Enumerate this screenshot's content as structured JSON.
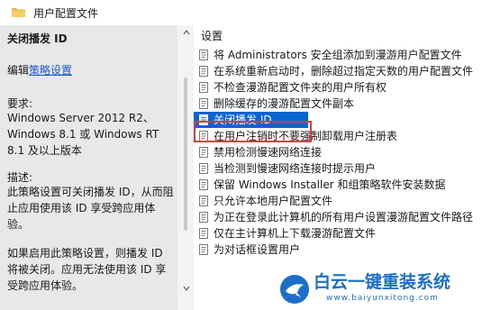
{
  "header": {
    "title": "用户配置文件"
  },
  "left_panel": {
    "title": "关闭播发 ID",
    "edit_prefix": "编辑",
    "edit_link": "策略设置",
    "requirements_label": "要求:",
    "requirements_value": "Windows Server 2012 R2、Windows 8.1 或 Windows RT 8.1 及以上版本",
    "description_label": "描述:",
    "description_value": "此策略设置可关闭播发 ID，从而阻止应用使用该 ID 享受跨应用体验。",
    "enabled_text": "如果启用此策略设置，则播发 ID 将被关闭。应用无法使用该 ID 享受跨应用体验。"
  },
  "list": {
    "column_header": "设置",
    "items": [
      {
        "label": "将 Administrators 安全组添加到漫游用户配置文件",
        "selected": false
      },
      {
        "label": "在系统重新启动时，删除超过指定天数的用户配置文件",
        "selected": false
      },
      {
        "label": "不检查漫游配置文件夹的用户所有权",
        "selected": false
      },
      {
        "label": "删除缓存的漫游配置文件副本",
        "selected": false
      },
      {
        "label": "关闭播发 ID",
        "selected": true
      },
      {
        "label": "在用户注销时不要强制卸载用户注册表",
        "selected": false
      },
      {
        "label": "禁用检测慢速网络连接",
        "selected": false
      },
      {
        "label": "当检测到慢速网络连接时提示用户",
        "selected": false
      },
      {
        "label": "保留 Windows Installer 和组策略软件安装数据",
        "selected": false
      },
      {
        "label": "只允许本地用户配置文件",
        "selected": false
      },
      {
        "label": "为正在登录此计算机的所有用户设置漫游配置文件路径",
        "selected": false
      },
      {
        "label": "仅在主计算机上下载漫游配置文件",
        "selected": false
      },
      {
        "label": "为对话框设置用户",
        "selected": false
      }
    ]
  },
  "watermark": {
    "brand": "白云一键重装系统",
    "url": "www.baiyunxitong.com"
  },
  "colors": {
    "selection": "#0a64d2",
    "highlight_outline": "#e23b3b",
    "link": "#1a59c5",
    "brand": "#1b6fc9"
  },
  "icons": {
    "folder": "folder-icon",
    "policy": "policy-setting-icon",
    "brand": "bird-logo-icon"
  }
}
